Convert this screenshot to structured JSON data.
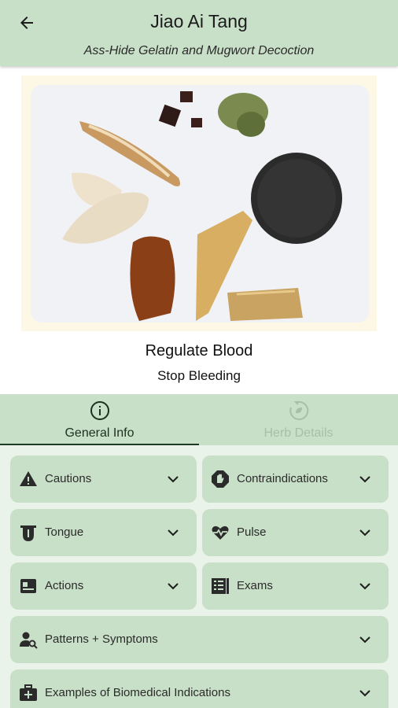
{
  "header": {
    "title": "Jiao Ai Tang",
    "subtitle": "Ass-Hide Gelatin and Mugwort Decoction",
    "back_icon": "arrow-left-icon"
  },
  "colors": {
    "header_bg": "#c8dfc8",
    "card_bg": "#c8dfc8",
    "content_bg": "#e9f3e9",
    "frame_bg": "#fdf8e6",
    "tab_indicator": "#1d3a22",
    "inactive_tab": "#a9bea9"
  },
  "actions": {
    "primary": "Regulate Blood",
    "secondary": "Stop Bleeding"
  },
  "tabs": [
    {
      "label": "General Info",
      "icon": "info-circle-icon",
      "active": true
    },
    {
      "label": "Herb Details",
      "icon": "herb-cycle-icon",
      "active": false
    }
  ],
  "cards": {
    "cautions": {
      "label": "Cautions",
      "icon": "warning-icon"
    },
    "contraindications": {
      "label": "Contraindications",
      "icon": "hand-stop-icon"
    },
    "tongue": {
      "label": "Tongue",
      "icon": "tongue-icon"
    },
    "pulse": {
      "label": "Pulse",
      "icon": "heart-pulse-icon"
    },
    "actions": {
      "label": "Actions",
      "icon": "id-card-icon"
    },
    "exams": {
      "label": "Exams",
      "icon": "checklist-icon"
    },
    "patterns": {
      "label": "Patterns + Symptoms",
      "icon": "person-search-icon"
    },
    "biomedical": {
      "label": "Examples of Biomedical Indications",
      "icon": "medical-kit-icon"
    }
  }
}
